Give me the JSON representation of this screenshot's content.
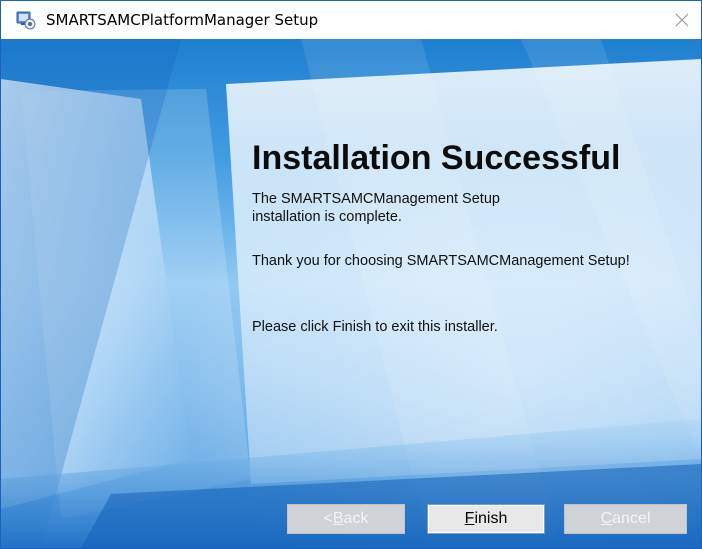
{
  "window": {
    "title": "SMARTSAMCPlatformManager Setup",
    "title_icon": "installer-icon",
    "close_icon": "close-icon",
    "accent_border": "#1b5fbf"
  },
  "content": {
    "heading": "Installation Successful",
    "line1": "The SMARTSAMCManagement  Setup",
    "line2": "installation is complete.",
    "thank_you": "Thank you for choosing SMARTSAMCManagement Setup!",
    "instruction": "Please click Finish to exit this installer.",
    "background_colors": [
      "#1f7fd0",
      "#8cc6f2",
      "#3b8fdc"
    ]
  },
  "buttons": {
    "back": {
      "prefix": "< ",
      "accel": "B",
      "rest": "ack",
      "enabled": false
    },
    "finish": {
      "prefix": "",
      "accel": "F",
      "rest": "inish",
      "enabled": true
    },
    "cancel": {
      "prefix": "",
      "accel": "C",
      "rest": "ancel",
      "enabled": false
    }
  }
}
